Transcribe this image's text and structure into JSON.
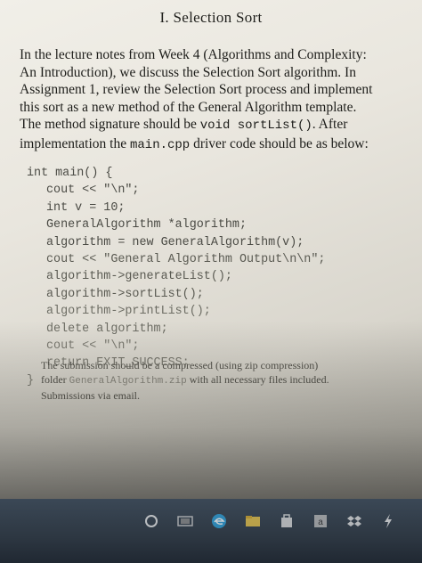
{
  "document": {
    "title": "I. Selection Sort",
    "paragraph": {
      "text1": "In the lecture notes from Week 4 (Algorithms and Complexity: An Introduction), we discuss the Selection Sort algorithm. In Assignment 1, review the Selection Sort process and implement this sort as a new method of the General Algorithm template. The method signature should be ",
      "code1": "void sortList()",
      "text2": ". After implementation the ",
      "code2": "main.cpp",
      "text3": " driver code should be as below:"
    },
    "code_lines": [
      "int main() {",
      "cout << \"\\n\";",
      "int v = 10;",
      "GeneralAlgorithm *algorithm;",
      "algorithm = new GeneralAlgorithm(v);",
      "cout << \"General Algorithm Output\\n\\n\";",
      "algorithm->generateList();",
      "algorithm->sortList();",
      "algorithm->printList();",
      "delete algorithm;",
      "cout << \"\\n\";",
      "return EXIT_SUCCESS;",
      "}"
    ],
    "note": {
      "text1": "The submission should be a compressed (using zip compression) folder ",
      "code": "GeneralAlgorithm.zip",
      "text2": " with all necessary files included. Submissions via email."
    }
  },
  "taskbar": {
    "icons": [
      "search-icon",
      "task-view-icon",
      "edge-icon",
      "file-explorer-icon",
      "store-icon",
      "amazon-icon",
      "dropbox-icon",
      "flash-icon"
    ],
    "accent": "#2d3742"
  }
}
